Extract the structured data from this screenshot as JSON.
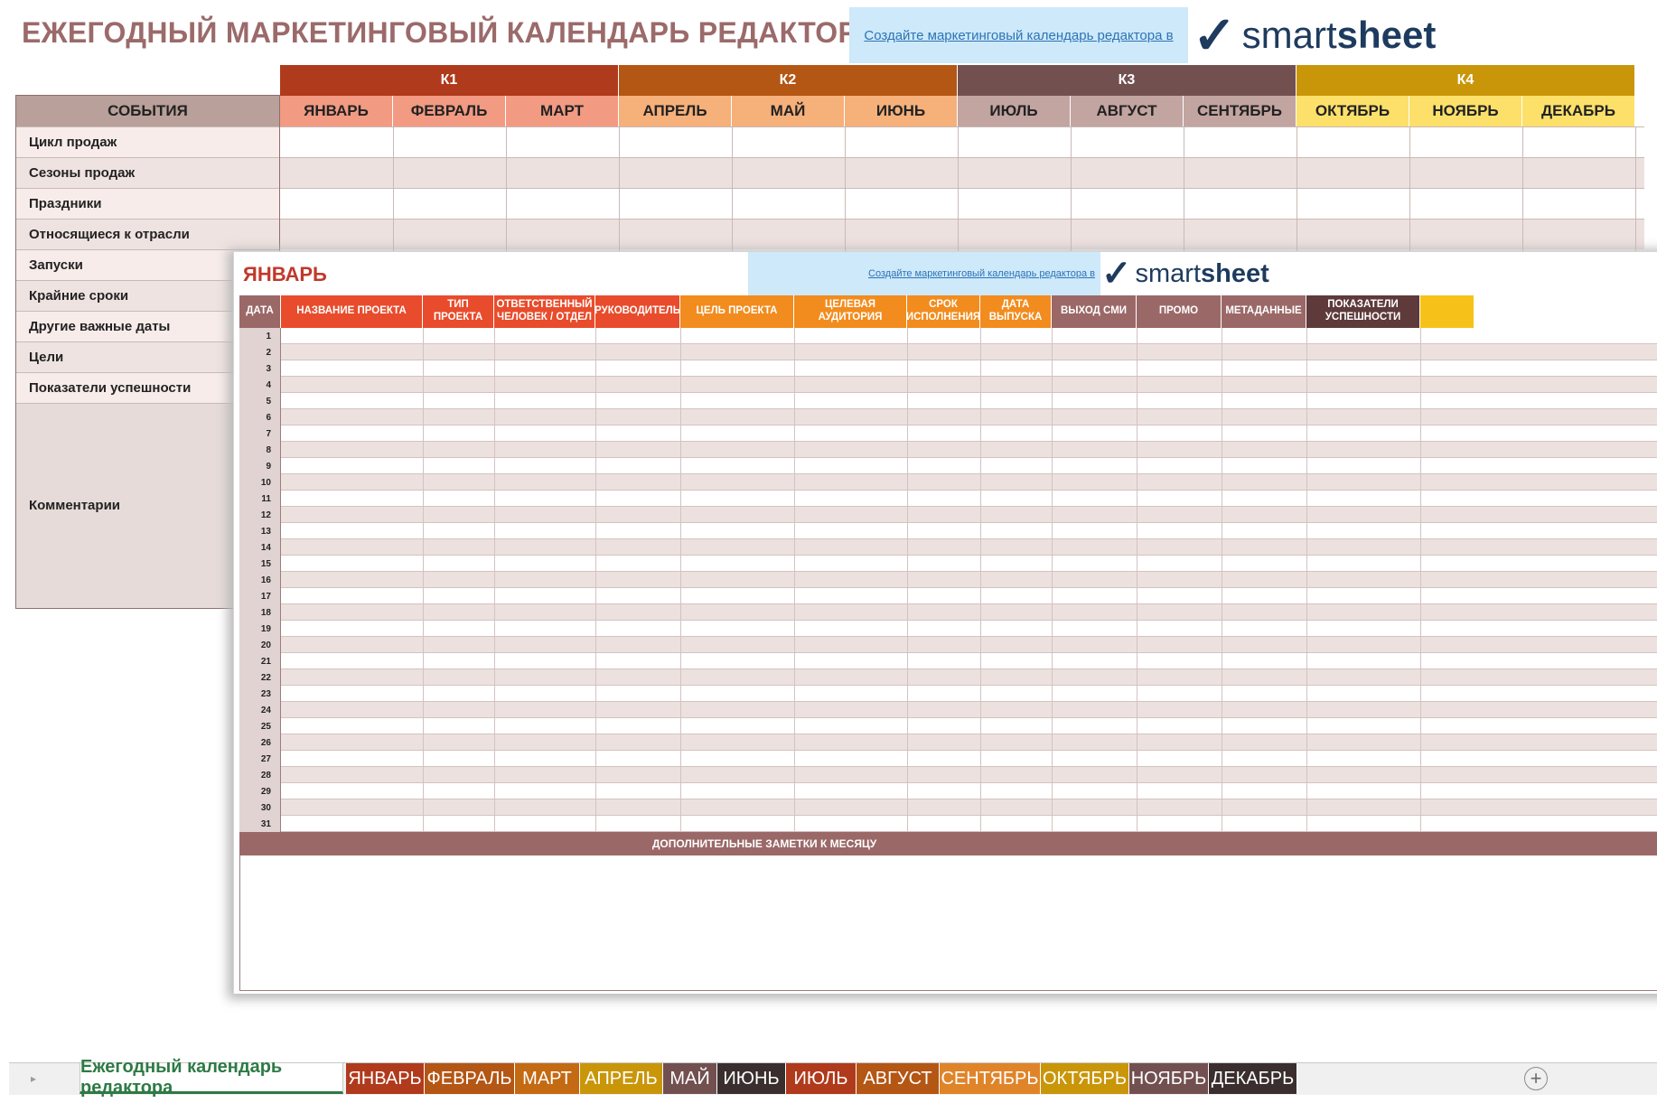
{
  "back_sheet": {
    "title": "ЕЖЕГОДНЫЙ МАРКЕТИНГОВЫЙ КАЛЕНДАРЬ РЕДАКТОРА",
    "promo_link": "Создайте маркетинговый календарь редактора в",
    "logo": {
      "mark": "✓",
      "word_a": "smart",
      "word_b": "sheet"
    },
    "events_header": "СОБЫТИЯ",
    "quarters": [
      {
        "label": "К1",
        "color": "#b03a1c"
      },
      {
        "label": "К2",
        "color": "#b45614"
      },
      {
        "label": "К3",
        "color": "#735050"
      },
      {
        "label": "К4",
        "color": "#c9960a"
      }
    ],
    "months": [
      {
        "label": "ЯНВАРЬ",
        "color": "#f29a82"
      },
      {
        "label": "ФЕВРАЛЬ",
        "color": "#f29a82"
      },
      {
        "label": "МАРТ",
        "color": "#f29a82"
      },
      {
        "label": "АПРЕЛЬ",
        "color": "#f6b07a"
      },
      {
        "label": "МАЙ",
        "color": "#f6b07a"
      },
      {
        "label": "ИЮНЬ",
        "color": "#f6b07a"
      },
      {
        "label": "ИЮЛЬ",
        "color": "#c2a4a0"
      },
      {
        "label": "АВГУСТ",
        "color": "#c2a4a0"
      },
      {
        "label": "СЕНТЯБРЬ",
        "color": "#c2a4a0"
      },
      {
        "label": "ОКТЯБРЬ",
        "color": "#fde06a"
      },
      {
        "label": "НОЯБРЬ",
        "color": "#fde06a"
      },
      {
        "label": "ДЕКАБРЬ",
        "color": "#fde06a"
      }
    ],
    "rows": [
      "Цикл продаж",
      "Сезоны продаж",
      "Праздники",
      "Относящиеся к отрасли",
      "Запуски",
      "Крайние сроки",
      "Другие важные даты",
      "Цели",
      "Показатели успешности"
    ],
    "comments_label": "Комментарии"
  },
  "front_sheet": {
    "title": "ЯНВАРЬ",
    "promo_link": "Создайте маркетинговый календарь редактора в",
    "logo": {
      "mark": "✓",
      "word_a": "smart",
      "word_b": "sheet"
    },
    "columns": [
      {
        "label": "ДАТА",
        "color": "#9b6868"
      },
      {
        "label": "НАЗВАНИЕ ПРОЕКТА",
        "color": "#e84c2c"
      },
      {
        "label": "ТИП ПРОЕКТА",
        "color": "#e84c2c"
      },
      {
        "label": "ОТВЕТСТВЕННЫЙ ЧЕЛОВЕК / ОТДЕЛ",
        "color": "#e84c2c"
      },
      {
        "label": "РУКОВОДИТЕЛЬ",
        "color": "#e84c2c"
      },
      {
        "label": "ЦЕЛЬ ПРОЕКТА",
        "color": "#f28c1e"
      },
      {
        "label": "ЦЕЛЕВАЯ АУДИТОРИЯ",
        "color": "#f28c1e"
      },
      {
        "label": "СРОК ИСПОЛНЕНИЯ",
        "color": "#f28c1e"
      },
      {
        "label": "ДАТА ВЫПУСКА",
        "color": "#f28c1e"
      },
      {
        "label": "ВЫХОД СМИ",
        "color": "#9b6868"
      },
      {
        "label": "ПРОМО",
        "color": "#9b6868"
      },
      {
        "label": "МЕТАДАННЫЕ",
        "color": "#9b6868"
      },
      {
        "label": "ПОКАЗАТЕЛИ УСПЕШНОСТИ",
        "color": "#5e3a3a"
      },
      {
        "label": "",
        "color": "#f6c21a"
      }
    ],
    "dates": [
      "1",
      "2",
      "3",
      "4",
      "5",
      "6",
      "7",
      "8",
      "9",
      "10",
      "11",
      "12",
      "13",
      "14",
      "15",
      "16",
      "17",
      "18",
      "19",
      "20",
      "21",
      "22",
      "23",
      "24",
      "25",
      "26",
      "27",
      "28",
      "29",
      "30",
      "31"
    ],
    "notes_header": "ДОПОЛНИТЕЛЬНЫЕ ЗАМЕТКИ К МЕСЯЦУ"
  },
  "tabs": {
    "scroll_glyph": "▸",
    "add_glyph": "+",
    "main": "Ежегодный календарь редактора",
    "months": [
      {
        "label": "ЯНВАРЬ",
        "color": "#b03a1c"
      },
      {
        "label": "ФЕВРАЛЬ",
        "color": "#b45614"
      },
      {
        "label": "МАРТ",
        "color": "#c46a12"
      },
      {
        "label": "АПРЕЛЬ",
        "color": "#c9960a"
      },
      {
        "label": "МАЙ",
        "color": "#735050"
      },
      {
        "label": "ИЮНЬ",
        "color": "#3a2e2e"
      },
      {
        "label": "ИЮЛЬ",
        "color": "#b03a1c"
      },
      {
        "label": "АВГУСТ",
        "color": "#b45614"
      },
      {
        "label": "СЕНТЯБРЬ",
        "color": "#e0842a"
      },
      {
        "label": "ОКТЯБРЬ",
        "color": "#c9960a"
      },
      {
        "label": "НОЯБРЬ",
        "color": "#735050"
      },
      {
        "label": "ДЕКАБРЬ",
        "color": "#3a2e2e"
      }
    ]
  }
}
